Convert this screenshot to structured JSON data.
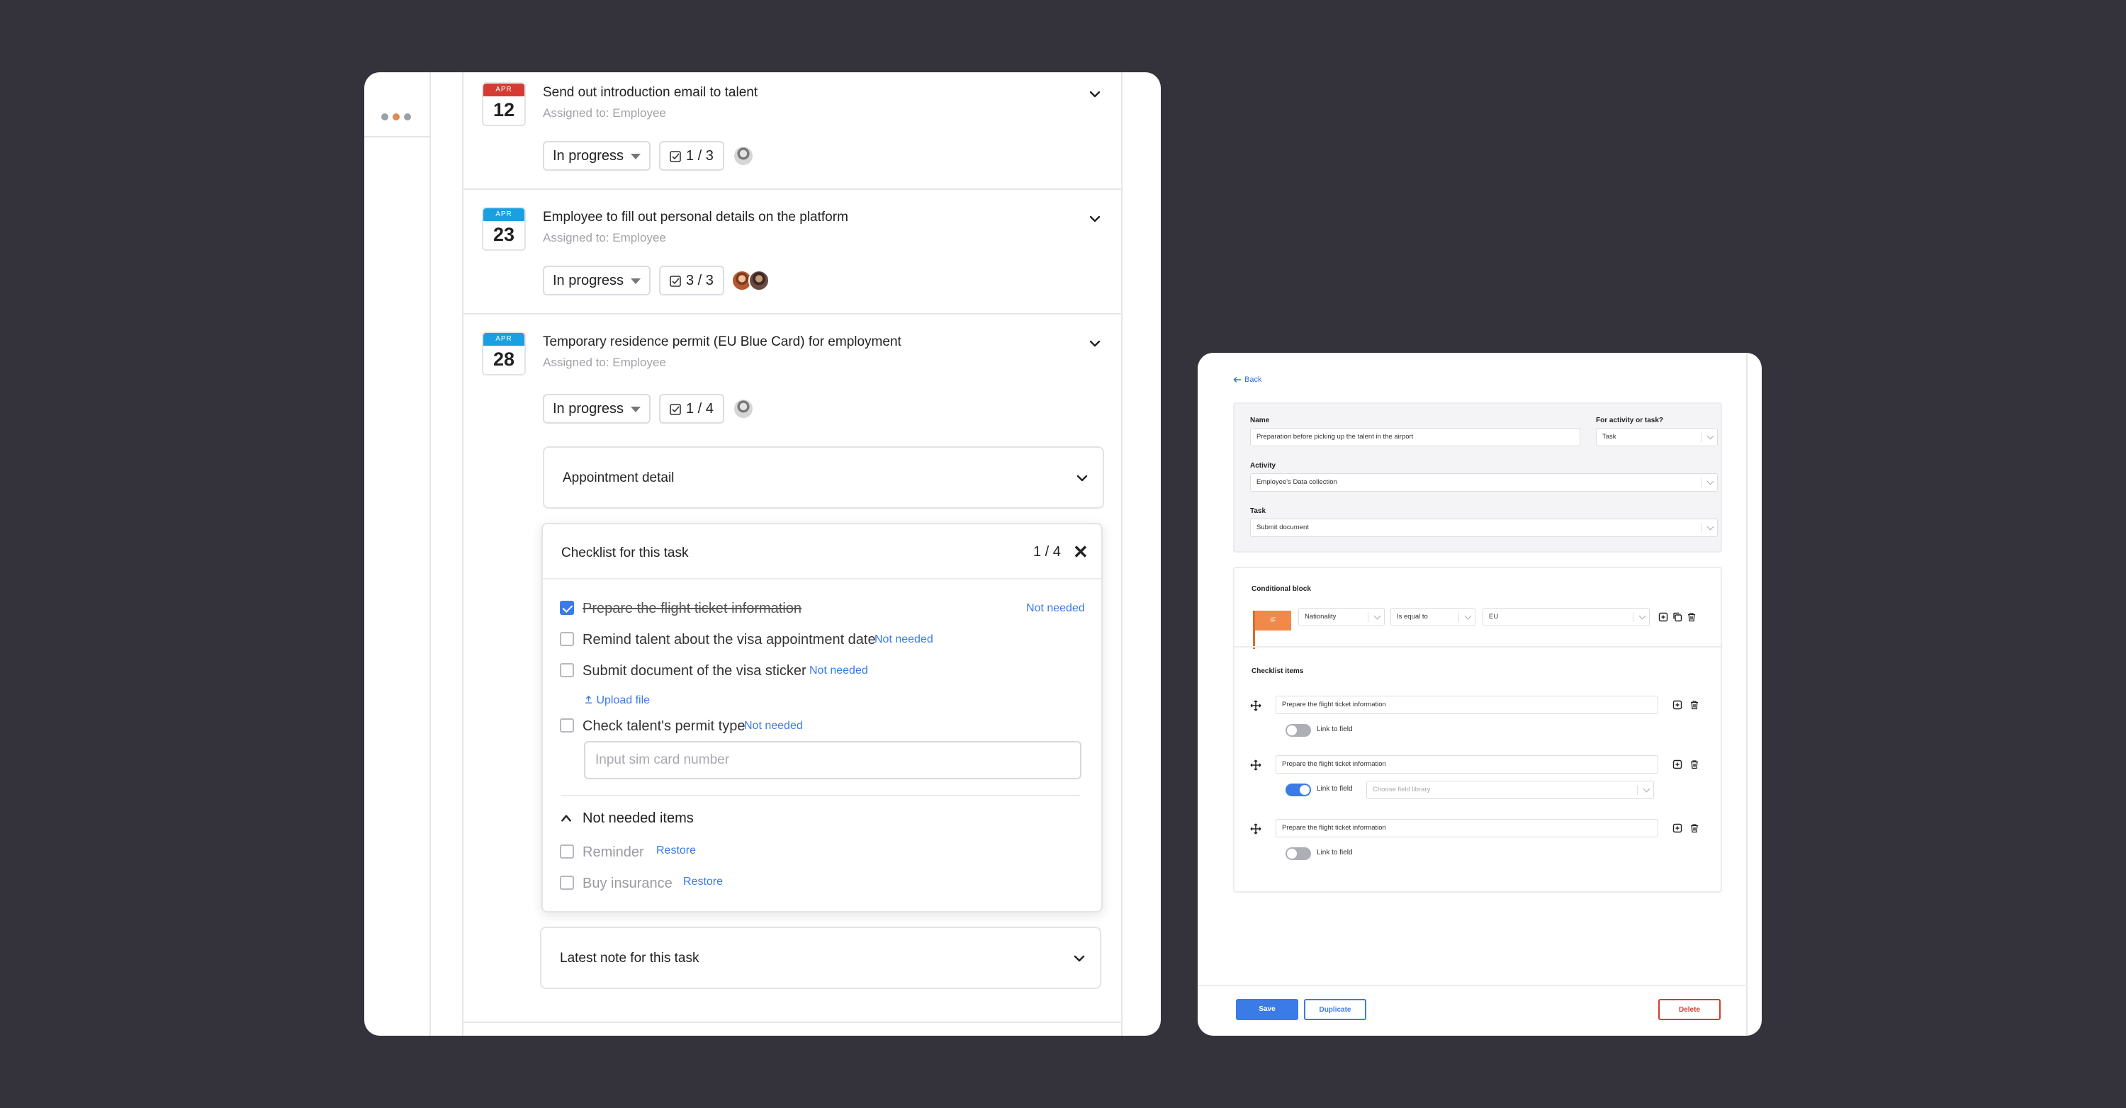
{
  "tasks": [
    {
      "month": "APR",
      "day": "12",
      "title": "Send out introduction email to talent",
      "assigned": "Assigned to: Employee",
      "status": "In progress",
      "progress": "1 / 3"
    },
    {
      "month": "APR",
      "day": "23",
      "title": "Employee to fill out personal details on the platform",
      "assigned": "Assigned to: Employee",
      "status": "In progress",
      "progress": "3 / 3"
    },
    {
      "month": "APR",
      "day": "28",
      "title": "Temporary residence permit (EU Blue Card) for employment",
      "assigned": "Assigned to: Employee",
      "status": "In progress",
      "progress": "1 / 4"
    }
  ],
  "appointment": {
    "title": "Appointment detail"
  },
  "checklist": {
    "title": "Checklist for this task",
    "progress": "1 / 4",
    "close": "✕",
    "items": [
      {
        "label": "Prepare the flight ticket information",
        "action": "Not needed",
        "checked": true
      },
      {
        "label": "Remind talent about the visa appointment date",
        "action": "Not needed",
        "checked": false
      },
      {
        "label": "Submit document of the visa sticker",
        "action": "Not needed",
        "checked": false
      },
      {
        "label": "Check talent's permit type",
        "action": "Not needed",
        "checked": false
      }
    ],
    "upload_label": "Upload file",
    "sim_placeholder": "Input sim card number",
    "not_needed_title": "Not needed items",
    "not_needed_items": [
      {
        "label": "Reminder",
        "action": "Restore"
      },
      {
        "label": "Buy insurance",
        "action": "Restore"
      }
    ]
  },
  "latest_note": {
    "title": "Latest note for this task"
  },
  "editor": {
    "back": "Back",
    "name_label": "Name",
    "name_value": "Preparation before picking up the talent in the airport",
    "for_label": "For activity or task?",
    "for_value": "Task",
    "activity_label": "Activity",
    "activity_value": "Employee's Data collection",
    "task_label": "Task",
    "task_value": "Submit document",
    "conditional_title": "Conditional block",
    "if_label": "IF",
    "cond_field": "Nationality",
    "cond_op": "Is equal to",
    "cond_value": "EU",
    "checklist_title": "Checklist items",
    "items": [
      {
        "value": "Prepare the flight ticket information",
        "toggle_label": "Link to field",
        "linked": false
      },
      {
        "value": "Prepare the flight ticket information",
        "toggle_label": "Link to field",
        "linked": true,
        "field_placeholder": "Choose field library"
      },
      {
        "value": "Prepare the flight ticket information",
        "toggle_label": "Link to field",
        "linked": false
      }
    ],
    "save": "Save",
    "duplicate": "Duplicate",
    "delete": "Delete"
  },
  "colors": {
    "background": "#34333b",
    "accent": "#3a7be8",
    "danger": "#d63b33",
    "calendar_red": "#d63b33",
    "calendar_blue": "#1aa0e0",
    "if_orange": "#f0894a"
  }
}
